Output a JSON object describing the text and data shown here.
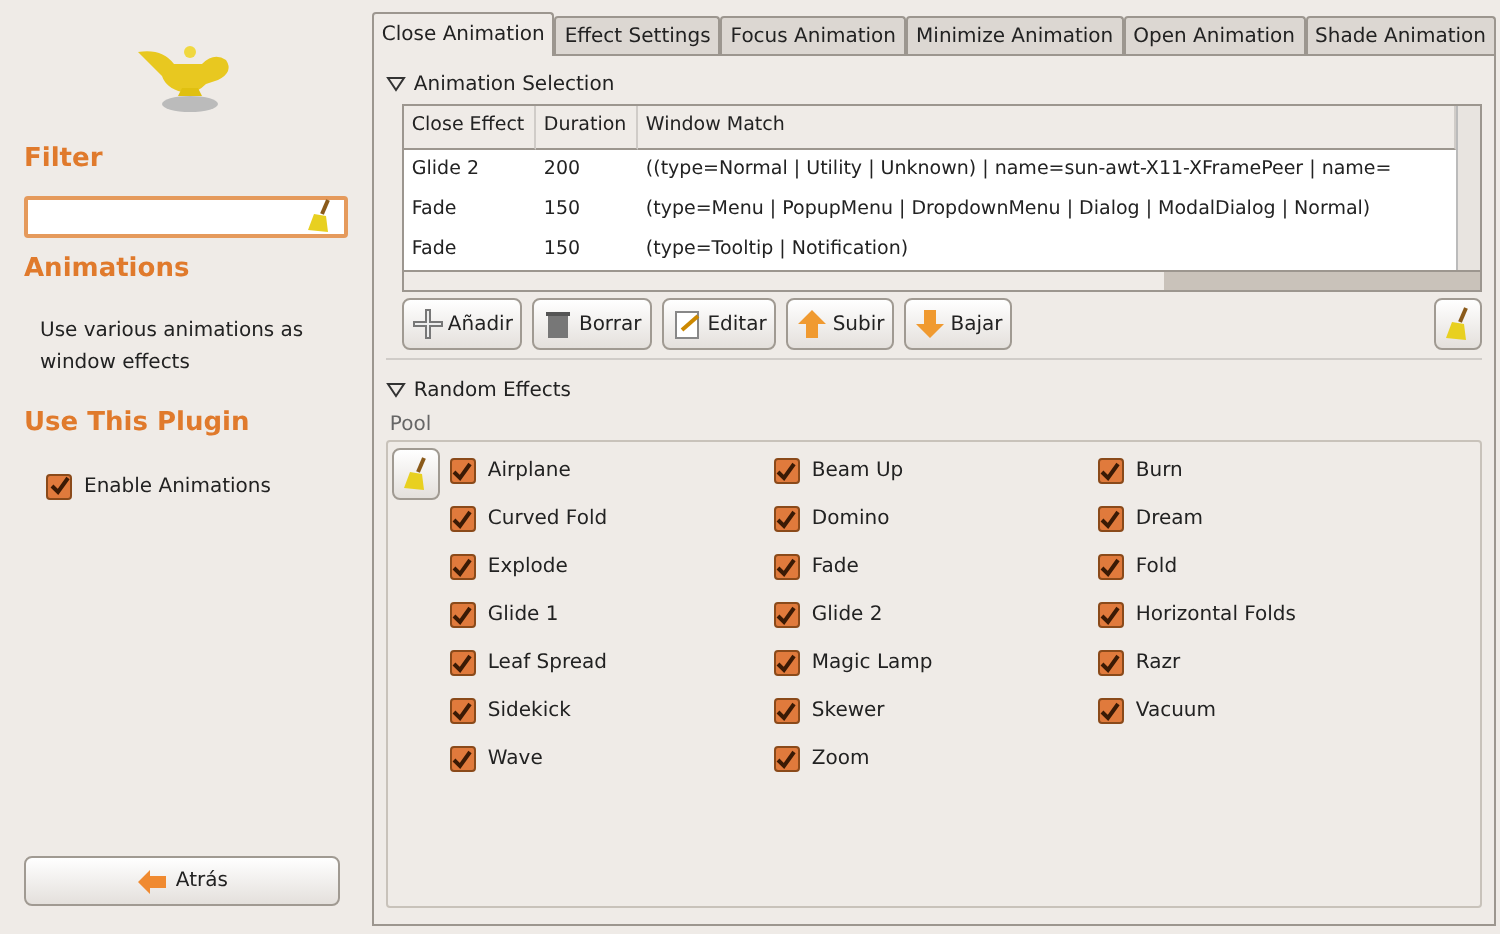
{
  "sidebar": {
    "filter": {
      "heading": "Filter"
    },
    "plugin": {
      "heading": "Animations",
      "description": "Use various animations as window effects"
    },
    "use_plugin": {
      "heading": "Use This Plugin",
      "label": "Enable Animations",
      "checked": true
    },
    "back_button": "Atrás"
  },
  "tabs": [
    {
      "label": "Close Animation",
      "selected": true
    },
    {
      "label": "Effect Settings",
      "selected": false
    },
    {
      "label": "Focus Animation",
      "selected": false
    },
    {
      "label": "Minimize Animation",
      "selected": false
    },
    {
      "label": "Open Animation",
      "selected": false
    },
    {
      "label": "Shade Animation",
      "selected": false
    }
  ],
  "animation_selection": {
    "title": "Animation Selection",
    "expanded": true,
    "columns": [
      "Close Effect",
      "Duration",
      "Window Match"
    ],
    "rows": [
      [
        "Glide 2",
        "200",
        "((type=Normal | Utility | Unknown) | name=sun-awt-X11-XFramePeer | name="
      ],
      [
        "Fade",
        "150",
        "(type=Menu | PopupMenu | DropdownMenu | Dialog | ModalDialog | Normal)"
      ],
      [
        "Fade",
        "150",
        "(type=Tooltip | Notification)"
      ]
    ],
    "buttons": [
      {
        "kind": "add",
        "label": "Añadir"
      },
      {
        "kind": "delete",
        "label": "Borrar"
      },
      {
        "kind": "edit",
        "label": "Editar"
      },
      {
        "kind": "up",
        "label": "Subir"
      },
      {
        "kind": "down",
        "label": "Bajar"
      }
    ]
  },
  "random_effects": {
    "title": "Random Effects",
    "expanded": true,
    "pool_label": "Pool",
    "items": [
      {
        "label": "Airplane",
        "checked": true
      },
      {
        "label": "Beam Up",
        "checked": true
      },
      {
        "label": "Burn",
        "checked": true
      },
      {
        "label": "Curved Fold",
        "checked": true
      },
      {
        "label": "Domino",
        "checked": true
      },
      {
        "label": "Dream",
        "checked": true
      },
      {
        "label": "Explode",
        "checked": true
      },
      {
        "label": "Fade",
        "checked": true
      },
      {
        "label": "Fold",
        "checked": true
      },
      {
        "label": "Glide 1",
        "checked": true
      },
      {
        "label": "Glide 2",
        "checked": true
      },
      {
        "label": "Horizontal Folds",
        "checked": true
      },
      {
        "label": "Leaf Spread",
        "checked": true
      },
      {
        "label": "Magic Lamp",
        "checked": true
      },
      {
        "label": "Razr",
        "checked": true
      },
      {
        "label": "Sidekick",
        "checked": true
      },
      {
        "label": "Skewer",
        "checked": true
      },
      {
        "label": "Vacuum",
        "checked": true
      },
      {
        "label": "Wave",
        "checked": true
      },
      {
        "label": "Zoom",
        "checked": true
      }
    ]
  }
}
